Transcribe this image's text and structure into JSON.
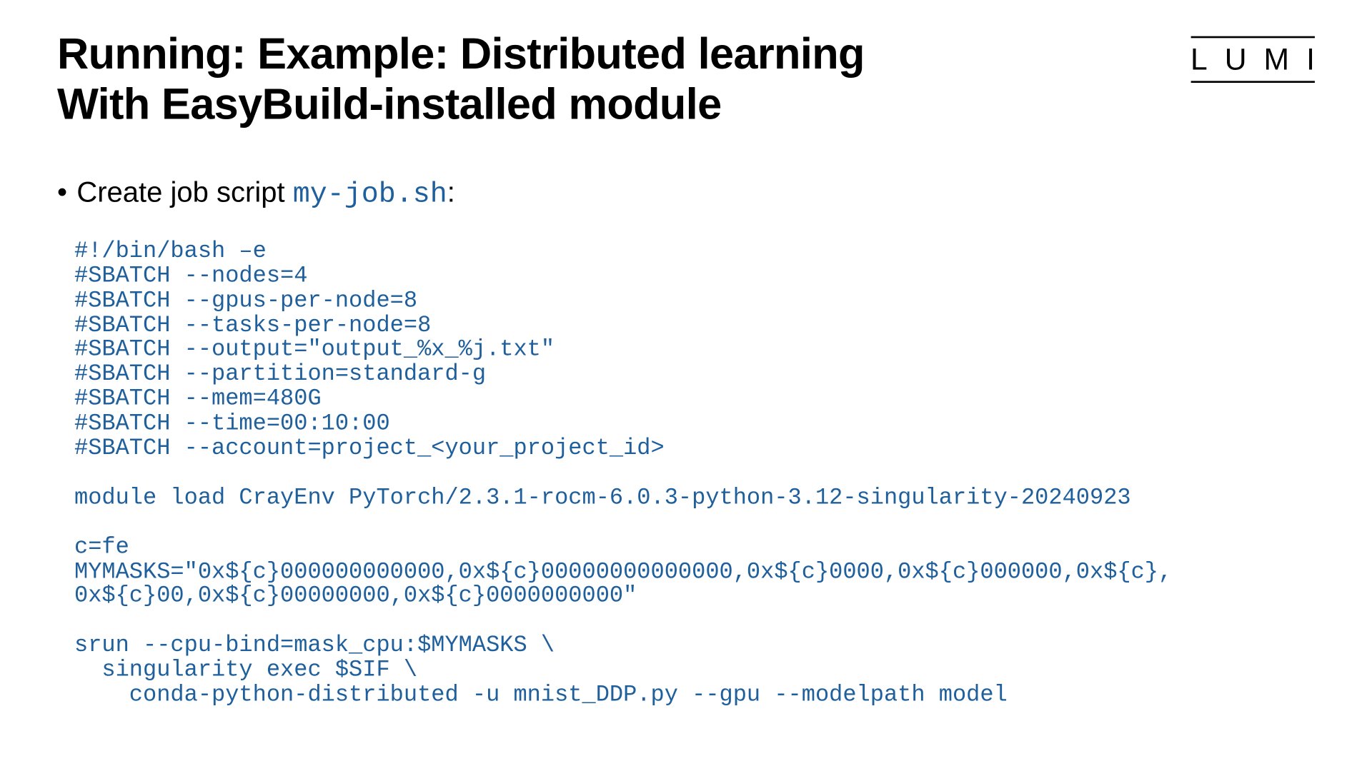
{
  "logo": "LUMI",
  "title_line1": "Running: Example: Distributed learning",
  "title_line2": "With EasyBuild-installed module",
  "bullet": {
    "prefix": "Create job script ",
    "filename": "my-job.sh",
    "suffix": ":"
  },
  "code": "#!/bin/bash –e\n#SBATCH --nodes=4\n#SBATCH --gpus-per-node=8\n#SBATCH --tasks-per-node=8\n#SBATCH --output=\"output_%x_%j.txt\"\n#SBATCH --partition=standard-g\n#SBATCH --mem=480G\n#SBATCH --time=00:10:00\n#SBATCH --account=project_<your_project_id>\n\nmodule load CrayEnv PyTorch/2.3.1-rocm-6.0.3-python-3.12-singularity-20240923\n\nc=fe\nMYMASKS=\"0x${c}000000000000,0x${c}00000000000000,0x${c}0000,0x${c}000000,0x${c},\n0x${c}00,0x${c}00000000,0x${c}0000000000\"\n\nsrun --cpu-bind=mask_cpu:$MYMASKS \\\n  singularity exec $SIF \\\n    conda-python-distributed -u mnist_DDP.py --gpu --modelpath model"
}
